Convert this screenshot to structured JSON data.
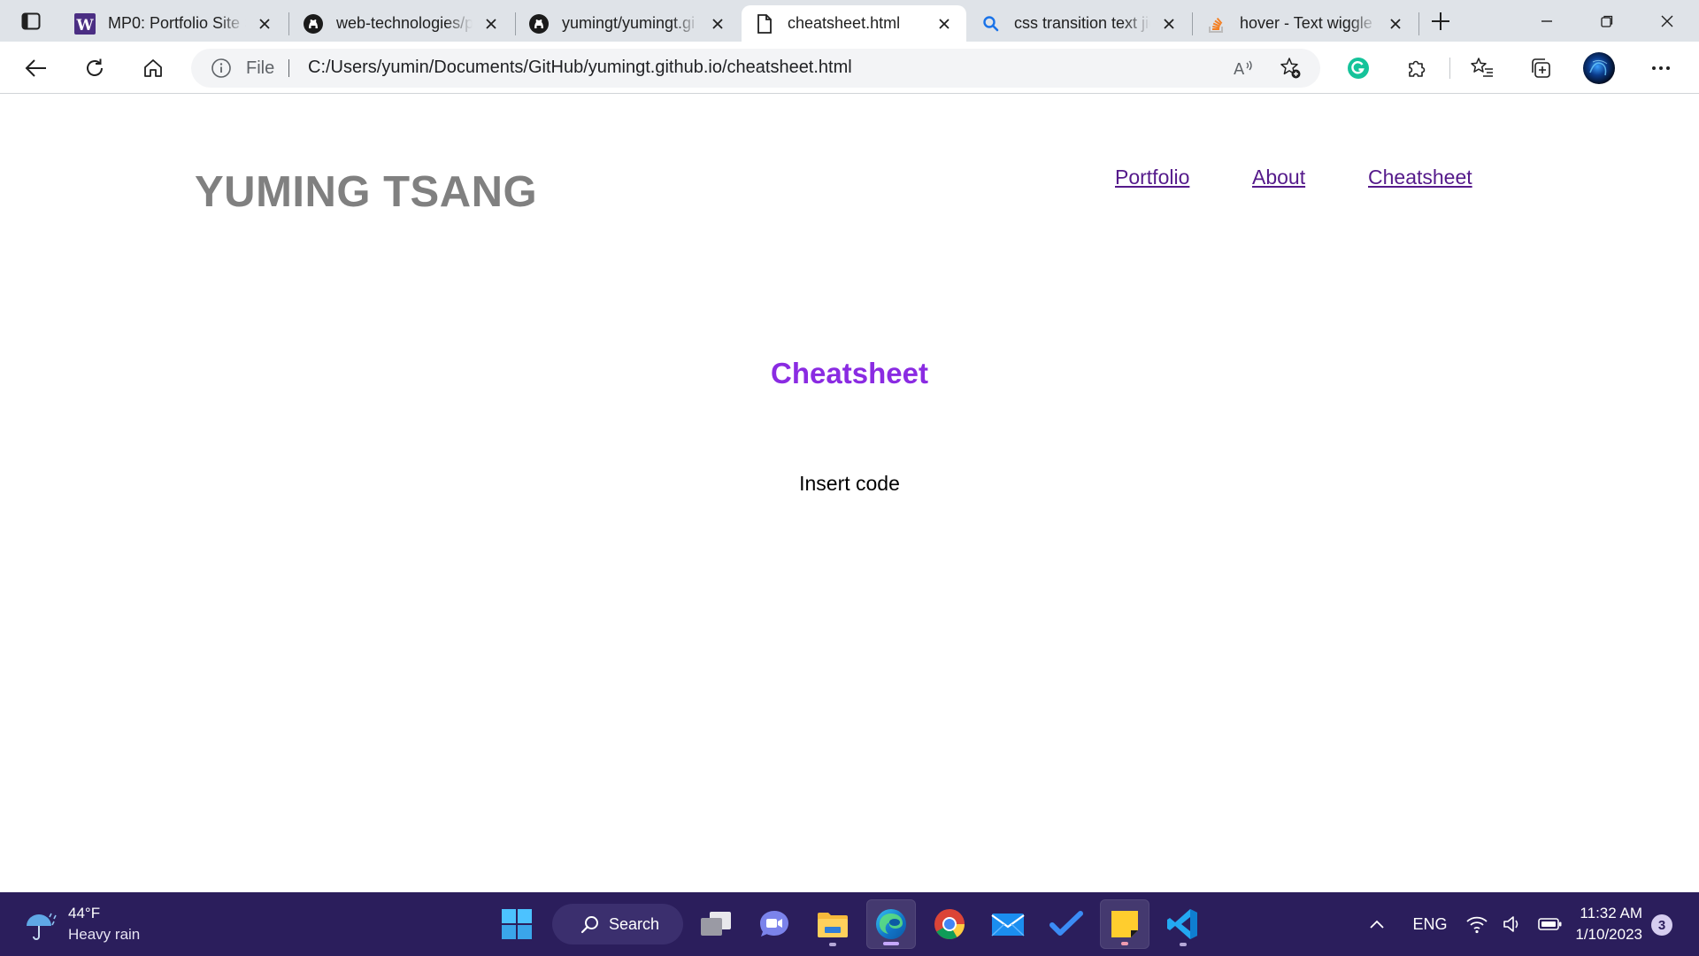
{
  "browser": {
    "tabs": [
      {
        "title": "MP0: Portfolio Site S",
        "icon": "w-icon"
      },
      {
        "title": "web-technologies/p",
        "icon": "github-icon"
      },
      {
        "title": "yumingt/yumingt.gi",
        "icon": "github-icon"
      },
      {
        "title": "cheatsheet.html",
        "icon": "file-icon"
      },
      {
        "title": "css transition text jig",
        "icon": "search-icon"
      },
      {
        "title": "hover - Text wiggle",
        "icon": "stackoverflow-icon"
      }
    ],
    "active_tab_index": 3,
    "address": {
      "scheme_label": "File",
      "url": "C:/Users/yumin/Documents/GitHub/yumingt.github.io/cheatsheet.html"
    }
  },
  "site": {
    "title": "YUMING TSANG",
    "nav": [
      "Portfolio",
      "About",
      "Cheatsheet"
    ],
    "heading": "Cheatsheet",
    "body": "Insert code",
    "colors": {
      "title": "#808080",
      "heading": "#8a2be2",
      "link": "#551a8b"
    }
  },
  "taskbar": {
    "weather": {
      "temp": "44°F",
      "desc": "Heavy rain"
    },
    "search_label": "Search",
    "apps": [
      "windows-start-icon",
      "task-view-icon",
      "teams-chat-icon",
      "file-explorer-icon",
      "edge-icon",
      "chrome-icon",
      "mail-icon",
      "todo-icon",
      "sticky-notes-icon",
      "vscode-icon"
    ],
    "tray": {
      "language": "ENG",
      "time": "11:32 AM",
      "date": "1/10/2023",
      "notifications": "3"
    }
  }
}
